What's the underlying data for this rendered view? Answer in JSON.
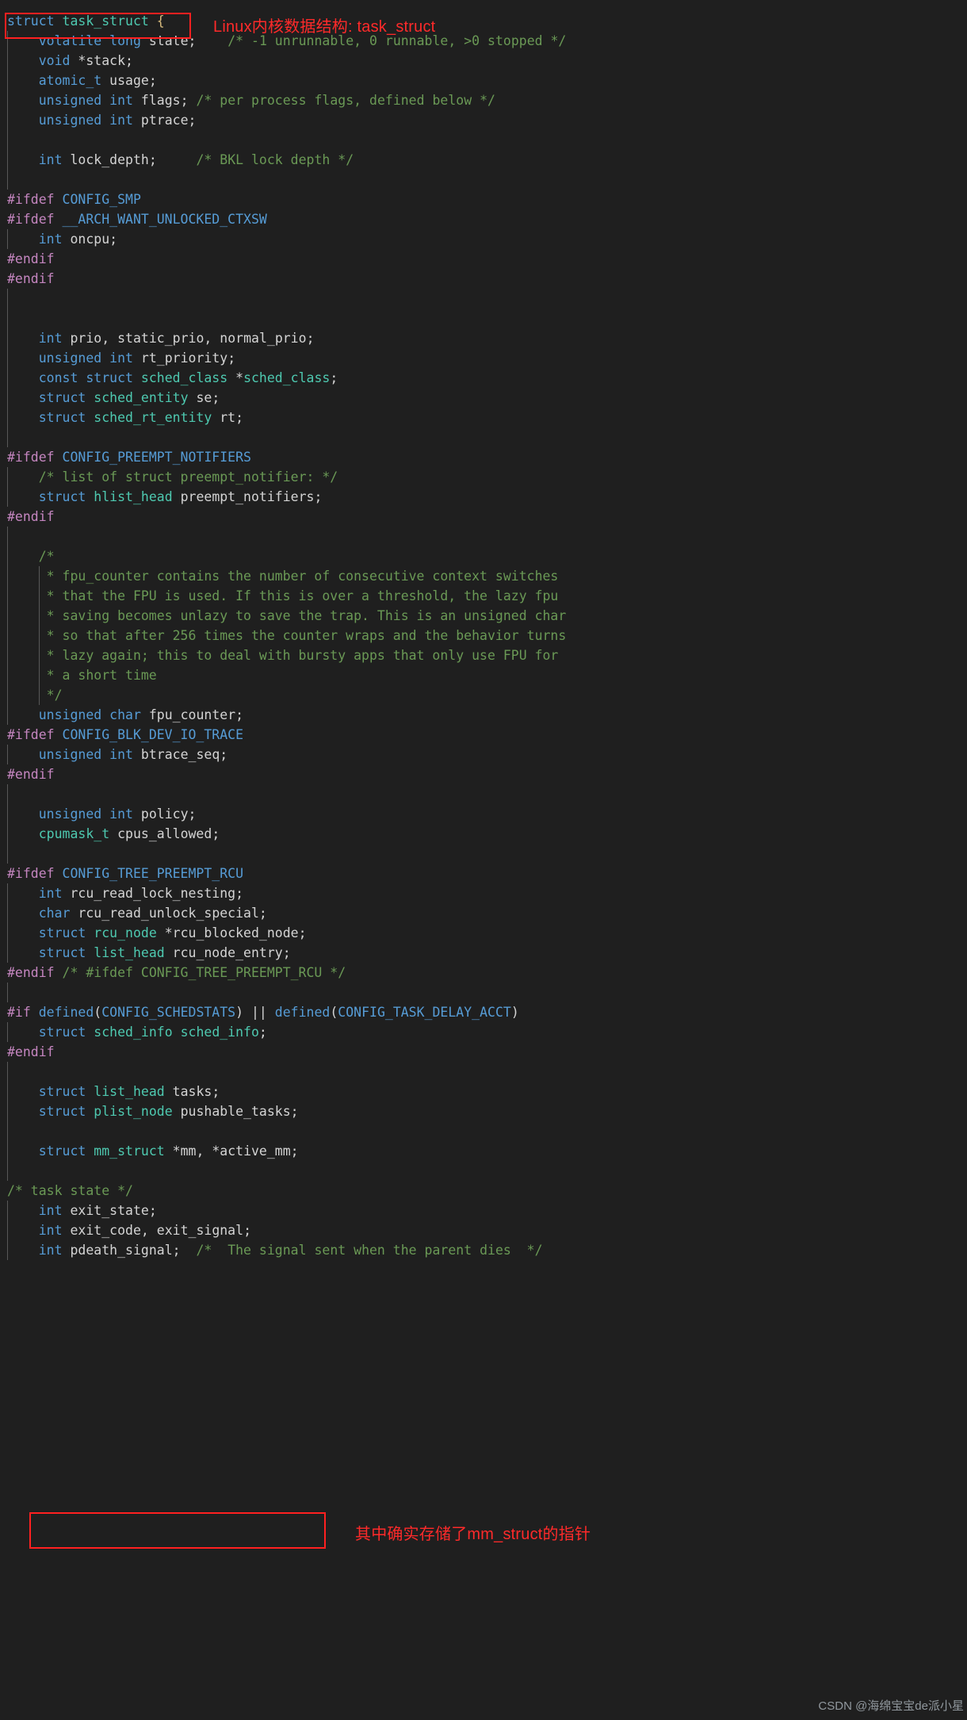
{
  "editor": {
    "background_color": "#1f1f1f",
    "colors": {
      "keyword": "#569cd6",
      "type": "#4ec9b0",
      "identifier": "#d4d4d4",
      "comment": "#6a9955",
      "preprocessor": "#c586c0",
      "brace": "#d7ba7d",
      "annotation_red": "#ff2a2a",
      "box_red": "#ff2020"
    },
    "language": "c",
    "file_content_title": "struct task_struct {"
  },
  "annotations": {
    "title_note": "Linux内核数据结构: task_struct",
    "mm_note": "其中确实存储了mm_struct的指针",
    "boxes": [
      {
        "name": "struct-header-box",
        "target": "struct task_struct {"
      },
      {
        "name": "mm-struct-box",
        "target": "struct mm_struct *mm, *active_mm;"
      }
    ]
  },
  "watermark": {
    "text": "CSDN @海绵宝宝de派小星"
  },
  "code_lines": [
    {
      "n": 1,
      "indent": 0,
      "guides": 0,
      "text": "struct task_struct {"
    },
    {
      "n": 2,
      "indent": 1,
      "guides": 1,
      "text": "    volatile long state;    /* -1 unrunnable, 0 runnable, >0 stopped */"
    },
    {
      "n": 3,
      "indent": 1,
      "guides": 1,
      "text": "    void *stack;"
    },
    {
      "n": 4,
      "indent": 1,
      "guides": 1,
      "text": "    atomic_t usage;"
    },
    {
      "n": 5,
      "indent": 1,
      "guides": 1,
      "text": "    unsigned int flags; /* per process flags, defined below */"
    },
    {
      "n": 6,
      "indent": 1,
      "guides": 1,
      "text": "    unsigned int ptrace;"
    },
    {
      "n": 7,
      "indent": 1,
      "guides": 1,
      "text": ""
    },
    {
      "n": 8,
      "indent": 1,
      "guides": 1,
      "text": "    int lock_depth;     /* BKL lock depth */"
    },
    {
      "n": 9,
      "indent": 1,
      "guides": 1,
      "text": ""
    },
    {
      "n": 10,
      "indent": 0,
      "guides": 0,
      "text": "#ifdef CONFIG_SMP"
    },
    {
      "n": 11,
      "indent": 0,
      "guides": 0,
      "text": "#ifdef __ARCH_WANT_UNLOCKED_CTXSW"
    },
    {
      "n": 12,
      "indent": 1,
      "guides": 1,
      "text": "    int oncpu;"
    },
    {
      "n": 13,
      "indent": 0,
      "guides": 0,
      "text": "#endif"
    },
    {
      "n": 14,
      "indent": 0,
      "guides": 0,
      "text": "#endif"
    },
    {
      "n": 15,
      "indent": 1,
      "guides": 1,
      "text": ""
    },
    {
      "n": 16,
      "indent": 1,
      "guides": 1,
      "text": ""
    },
    {
      "n": 17,
      "indent": 1,
      "guides": 1,
      "text": "    int prio, static_prio, normal_prio;"
    },
    {
      "n": 18,
      "indent": 1,
      "guides": 1,
      "text": "    unsigned int rt_priority;"
    },
    {
      "n": 19,
      "indent": 1,
      "guides": 1,
      "text": "    const struct sched_class *sched_class;"
    },
    {
      "n": 20,
      "indent": 1,
      "guides": 1,
      "text": "    struct sched_entity se;"
    },
    {
      "n": 21,
      "indent": 1,
      "guides": 1,
      "text": "    struct sched_rt_entity rt;"
    },
    {
      "n": 22,
      "indent": 1,
      "guides": 1,
      "text": ""
    },
    {
      "n": 23,
      "indent": 0,
      "guides": 0,
      "text": "#ifdef CONFIG_PREEMPT_NOTIFIERS"
    },
    {
      "n": 24,
      "indent": 1,
      "guides": 1,
      "text": "    /* list of struct preempt_notifier: */"
    },
    {
      "n": 25,
      "indent": 1,
      "guides": 1,
      "text": "    struct hlist_head preempt_notifiers;"
    },
    {
      "n": 26,
      "indent": 0,
      "guides": 0,
      "text": "#endif"
    },
    {
      "n": 27,
      "indent": 1,
      "guides": 1,
      "text": ""
    },
    {
      "n": 28,
      "indent": 1,
      "guides": 1,
      "text": "    /*"
    },
    {
      "n": 29,
      "indent": 2,
      "guides": 2,
      "text": "     * fpu_counter contains the number of consecutive context switches"
    },
    {
      "n": 30,
      "indent": 2,
      "guides": 2,
      "text": "     * that the FPU is used. If this is over a threshold, the lazy fpu"
    },
    {
      "n": 31,
      "indent": 2,
      "guides": 2,
      "text": "     * saving becomes unlazy to save the trap. This is an unsigned char"
    },
    {
      "n": 32,
      "indent": 2,
      "guides": 2,
      "text": "     * so that after 256 times the counter wraps and the behavior turns"
    },
    {
      "n": 33,
      "indent": 2,
      "guides": 2,
      "text": "     * lazy again; this to deal with bursty apps that only use FPU for"
    },
    {
      "n": 34,
      "indent": 2,
      "guides": 2,
      "text": "     * a short time"
    },
    {
      "n": 35,
      "indent": 2,
      "guides": 2,
      "text": "     */"
    },
    {
      "n": 36,
      "indent": 1,
      "guides": 1,
      "text": "    unsigned char fpu_counter;"
    },
    {
      "n": 37,
      "indent": 0,
      "guides": 0,
      "text": "#ifdef CONFIG_BLK_DEV_IO_TRACE"
    },
    {
      "n": 38,
      "indent": 1,
      "guides": 1,
      "text": "    unsigned int btrace_seq;"
    },
    {
      "n": 39,
      "indent": 0,
      "guides": 0,
      "text": "#endif"
    },
    {
      "n": 40,
      "indent": 1,
      "guides": 1,
      "text": ""
    },
    {
      "n": 41,
      "indent": 1,
      "guides": 1,
      "text": "    unsigned int policy;"
    },
    {
      "n": 42,
      "indent": 1,
      "guides": 1,
      "text": "    cpumask_t cpus_allowed;"
    },
    {
      "n": 43,
      "indent": 1,
      "guides": 1,
      "text": ""
    },
    {
      "n": 44,
      "indent": 0,
      "guides": 0,
      "text": "#ifdef CONFIG_TREE_PREEMPT_RCU"
    },
    {
      "n": 45,
      "indent": 1,
      "guides": 1,
      "text": "    int rcu_read_lock_nesting;"
    },
    {
      "n": 46,
      "indent": 1,
      "guides": 1,
      "text": "    char rcu_read_unlock_special;"
    },
    {
      "n": 47,
      "indent": 1,
      "guides": 1,
      "text": "    struct rcu_node *rcu_blocked_node;"
    },
    {
      "n": 48,
      "indent": 1,
      "guides": 1,
      "text": "    struct list_head rcu_node_entry;"
    },
    {
      "n": 49,
      "indent": 0,
      "guides": 0,
      "text": "#endif /* #ifdef CONFIG_TREE_PREEMPT_RCU */"
    },
    {
      "n": 50,
      "indent": 1,
      "guides": 1,
      "text": ""
    },
    {
      "n": 51,
      "indent": 0,
      "guides": 0,
      "text": "#if defined(CONFIG_SCHEDSTATS) || defined(CONFIG_TASK_DELAY_ACCT)"
    },
    {
      "n": 52,
      "indent": 1,
      "guides": 1,
      "text": "    struct sched_info sched_info;"
    },
    {
      "n": 53,
      "indent": 0,
      "guides": 0,
      "text": "#endif"
    },
    {
      "n": 54,
      "indent": 1,
      "guides": 1,
      "text": ""
    },
    {
      "n": 55,
      "indent": 1,
      "guides": 1,
      "text": "    struct list_head tasks;"
    },
    {
      "n": 56,
      "indent": 1,
      "guides": 1,
      "text": "    struct plist_node pushable_tasks;"
    },
    {
      "n": 57,
      "indent": 1,
      "guides": 1,
      "text": ""
    },
    {
      "n": 58,
      "indent": 1,
      "guides": 1,
      "text": "    struct mm_struct *mm, *active_mm;"
    },
    {
      "n": 59,
      "indent": 1,
      "guides": 1,
      "text": ""
    },
    {
      "n": 60,
      "indent": 0,
      "guides": 0,
      "text": "/* task state */"
    },
    {
      "n": 61,
      "indent": 1,
      "guides": 1,
      "text": "    int exit_state;"
    },
    {
      "n": 62,
      "indent": 1,
      "guides": 1,
      "text": "    int exit_code, exit_signal;"
    },
    {
      "n": 63,
      "indent": 1,
      "guides": 1,
      "text": "    int pdeath_signal;  /*  The signal sent when the parent dies  */"
    }
  ],
  "highlight_rules": {
    "keywords": [
      "struct",
      "int",
      "unsigned",
      "const",
      "void",
      "char",
      "volatile",
      "long",
      "atomic_t",
      "defined"
    ],
    "types": [
      "task_struct",
      "sched_class",
      "sched_entity",
      "sched_rt_entity",
      "hlist_head",
      "mm_struct",
      "cpumask_t",
      "list_head",
      "plist_node",
      "rcu_node",
      "sched_info",
      "preempt_notifier"
    ],
    "preprocessor": [
      "#ifdef",
      "#endif",
      "#if"
    ],
    "macros": [
      "CONFIG_SMP",
      "__ARCH_WANT_UNLOCKED_CTXSW",
      "CONFIG_PREEMPT_NOTIFIERS",
      "CONFIG_BLK_DEV_IO_TRACE",
      "CONFIG_TREE_PREEMPT_RCU",
      "CONFIG_SCHEDSTATS",
      "CONFIG_TASK_DELAY_ACCT"
    ]
  }
}
